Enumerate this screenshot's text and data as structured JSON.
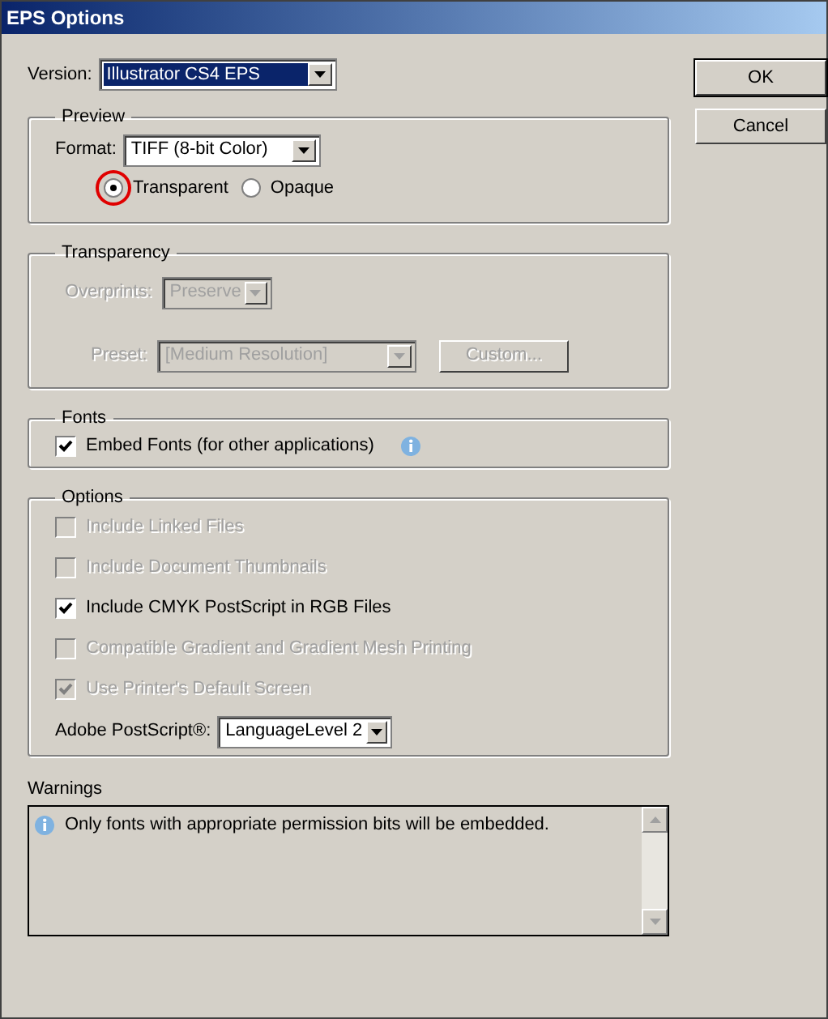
{
  "window": {
    "title": "EPS Options"
  },
  "version": {
    "label": "Version:",
    "value": "Illustrator CS4 EPS"
  },
  "preview": {
    "title": "Preview",
    "format": {
      "label": "Format:",
      "value": "TIFF (8-bit Color)"
    },
    "options": [
      {
        "label": "Transparent",
        "selected": true,
        "highlighted": true
      },
      {
        "label": "Opaque",
        "selected": false,
        "highlighted": false
      }
    ]
  },
  "transparency": {
    "title": "Transparency",
    "disabled": true,
    "overprints": {
      "label": "Overprints:",
      "value": "Preserve"
    },
    "preset": {
      "label": "Preset:",
      "value": "[Medium Resolution]"
    },
    "custom_button": "Custom..."
  },
  "fonts": {
    "title": "Fonts",
    "checkboxes": [
      {
        "label": "Embed Fonts (for other applications)",
        "checked": true,
        "disabled": false,
        "info": true
      }
    ]
  },
  "options": {
    "title": "Options",
    "checkboxes": [
      {
        "label": "Include Linked Files",
        "checked": false,
        "disabled": true,
        "info": false
      },
      {
        "label": "Include Document Thumbnails",
        "checked": false,
        "disabled": true,
        "info": false
      },
      {
        "label": "Include CMYK PostScript in RGB Files",
        "checked": true,
        "disabled": false,
        "info": false
      },
      {
        "label": "Compatible Gradient and Gradient Mesh Printing",
        "checked": false,
        "disabled": true,
        "info": false
      },
      {
        "label": "Use Printer's Default Screen",
        "checked": true,
        "disabled": true,
        "info": false
      }
    ],
    "postscript": {
      "label": "Adobe PostScript®:",
      "value": "LanguageLevel 2"
    }
  },
  "warnings": {
    "title": "Warnings",
    "messages": [
      "Only fonts with appropriate permission bits will be embedded."
    ]
  },
  "buttons": [
    {
      "label": "OK",
      "default": true
    },
    {
      "label": "Cancel",
      "default": false
    }
  ]
}
